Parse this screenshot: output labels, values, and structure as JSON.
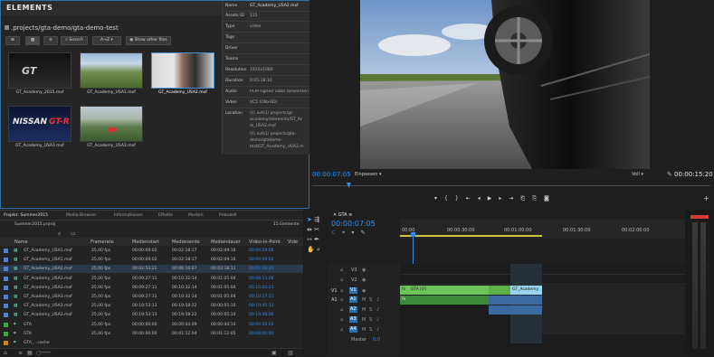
{
  "elements": {
    "logo": "ELEMENTS",
    "path": ".projects/gta-demo/gta-demo-test",
    "toolbar": {
      "search": "Search",
      "sort": "A→Z",
      "show_other": "Show other files"
    },
    "assets": [
      {
        "name": "GT_Academy_2015.mxf"
      },
      {
        "name": "GT_Academy_USA1.mxf"
      },
      {
        "name": "GT_Academy_USA2.mxf"
      },
      {
        "name": "GT_Academy_USA3.mxf"
      },
      {
        "name": "GT_Academy_USA3.mxf"
      }
    ],
    "info": {
      "rows": [
        {
          "k": "Name",
          "v": "GT_Academy_USA2.mxf"
        },
        {
          "k": "Assets ID",
          "v": "115"
        },
        {
          "k": "Type",
          "v": "video"
        },
        {
          "k": "Tags",
          "v": ""
        },
        {
          "k": "Driver",
          "v": ""
        },
        {
          "k": "Teams",
          "v": ""
        },
        {
          "k": "Resolution",
          "v": "1920x1080"
        },
        {
          "k": "Duration",
          "v": "0:05:18:10"
        },
        {
          "k": "Audio",
          "v": "PCM signed 16bit (bitwarden"
        },
        {
          "k": "Video",
          "v": "VC5 (DNxHD)"
        }
      ],
      "location_label": "Location",
      "location_lines": [
        "\\\\\\\\ avfs1/ projects/gt-",
        "academy/elements/GT_Ac",
        "m_USA2.mxf",
        "\\\\\\\\ avfs1/ projects/gta-",
        "demo/gtademo-",
        "test/GT_Academy_USA2.m"
      ]
    }
  },
  "program": {
    "tc_left": "00:00:07:05",
    "fit": "Einpassen",
    "quality": "Voll",
    "tc_right": "00:00:15:20"
  },
  "project": {
    "tabs": [
      "Projekt: Summer2015",
      "Media-Browser",
      "Informationen",
      "Effekte",
      "Marken",
      "Protokoll"
    ],
    "file": "Summer2015.prproj",
    "count": "15 Elemente",
    "columns": [
      "Name",
      "Framerate",
      "Medienstart",
      "Medienende",
      "Mediendauer",
      "Video-In-Point",
      "Vide"
    ],
    "rows": [
      {
        "name": "GT_Academy_USA1.mxf",
        "fr": "25,00 fps",
        "start": "00:00:09:02",
        "end": "00:02:18:17",
        "dur": "00:02:09:16",
        "in": "00:00:59:06"
      },
      {
        "name": "GT_Academy_USA1.mxf",
        "fr": "25,00 fps",
        "start": "00:00:09:02",
        "end": "00:02:18:17",
        "dur": "00:02:09:16",
        "in": "00:00:09:02"
      },
      {
        "name": "GT_Academy_USA2.mxf",
        "fr": "25,00 fps",
        "start": "00:02:53:22",
        "end": "00:06:10:07",
        "dur": "00:03:18:11",
        "in": "00:05:18:20"
      },
      {
        "name": "GT_Academy_USA3.mxf",
        "fr": "25,00 fps",
        "start": "00:09:27:11",
        "end": "00:10:32:14",
        "dur": "00:01:05:04",
        "in": "00:09:53:08"
      },
      {
        "name": "GT_Academy_USA3.mxf",
        "fr": "25,00 fps",
        "start": "00:09:27:11",
        "end": "00:10:32:14",
        "dur": "00:01:05:04",
        "in": "00:10:04:23"
      },
      {
        "name": "GT_Academy_USA3.mxf",
        "fr": "25,00 fps",
        "start": "00:09:27:11",
        "end": "00:10:32:14",
        "dur": "00:01:05:04",
        "in": "00:10:17:11"
      },
      {
        "name": "GT_Academy_USA3.mxf",
        "fr": "25,00 fps",
        "start": "00:19:53:13",
        "end": "00:19:58:22",
        "dur": "00:00:05:10",
        "in": "00:19:45:13"
      },
      {
        "name": "GT_Academy_USA3.mxf",
        "fr": "25,00 fps",
        "start": "00:19:53:13",
        "end": "00:19:58:22",
        "dur": "00:00:05:10",
        "in": "00:19:48:06"
      },
      {
        "name": "GTA",
        "fr": "25,00 fps",
        "start": "00:00:00:00",
        "end": "00:00:44:09",
        "dur": "00:00:44:10",
        "in": "00:00:00:00"
      },
      {
        "name": "GTA",
        "fr": "25,00 fps",
        "start": "00:00:00:00",
        "end": "00:01:12:04",
        "dur": "00:01:12:05",
        "in": "00:00:00:00"
      },
      {
        "name": "GTA_...cache",
        "fr": "",
        "start": "",
        "end": "",
        "dur": "",
        "in": ""
      }
    ],
    "row_colors": [
      "#5a7ec8",
      "#5a7ec8",
      "#5a7ec8",
      "#5a7ec8",
      "#5a7ec8",
      "#5a7ec8",
      "#5a7ec8",
      "#5a7ec8",
      "#3aa84a",
      "#3aa84a",
      "#d0822a"
    ]
  },
  "timeline": {
    "tab": "GTA",
    "tc": "00:00:07:05",
    "ruler": [
      "00:00",
      "00:00:30:00",
      "00:01:00:00",
      "00:01:30:00",
      "00:02:00:00"
    ],
    "tracks": [
      "V3",
      "V2",
      "V1",
      "A1",
      "A2",
      "A3",
      "A4"
    ],
    "src_v": "V1",
    "src_a": "A1",
    "master_label": "Master",
    "master_val": "0,0",
    "clips": {
      "v1a": "GTA [V]",
      "v1b": "GT_Academy",
      "fx": "fx"
    }
  }
}
